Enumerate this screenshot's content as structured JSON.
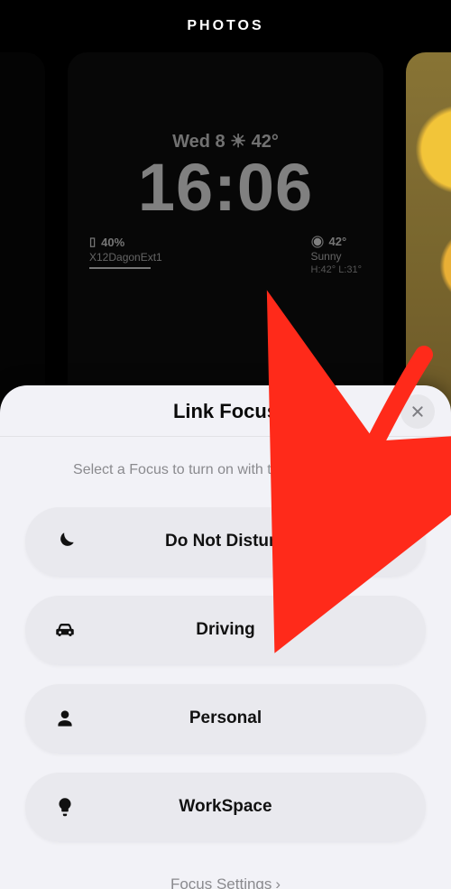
{
  "header": {
    "label": "PHOTOS"
  },
  "lockscreen": {
    "dateline": "Wed 8 ☀︎ 42°",
    "time": "16:06",
    "left_widget_top": "40%",
    "left_widget_bottom": "X12DagonExt1",
    "right_widget_top": "42°",
    "right_widget_mid": "Sunny",
    "right_widget_bottom": "H:42° L:31°"
  },
  "sheet": {
    "title": "Link Focus",
    "subtitle": "Select a Focus to turn on with this Lock Screen.",
    "footer": "Focus Settings"
  },
  "focuses": [
    {
      "icon": "moon-icon",
      "label": "Do Not Disturb"
    },
    {
      "icon": "car-icon",
      "label": "Driving"
    },
    {
      "icon": "person-icon",
      "label": "Personal"
    },
    {
      "icon": "bulb-icon",
      "label": "WorkSpace"
    }
  ]
}
